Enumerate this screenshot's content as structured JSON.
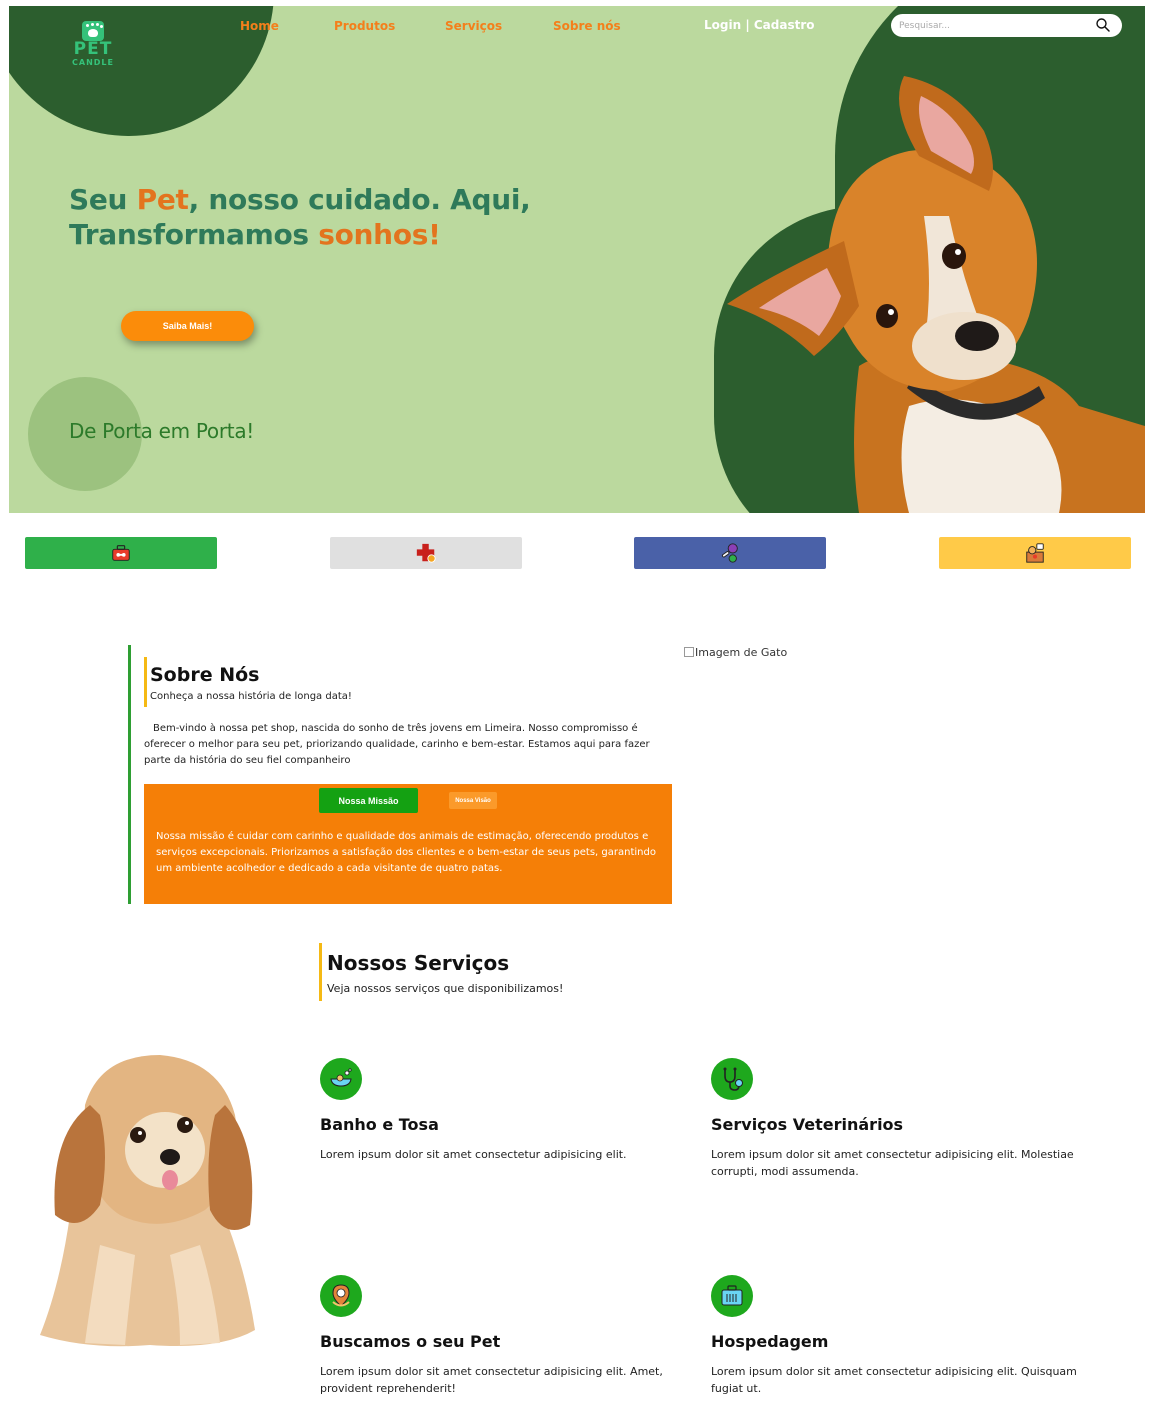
{
  "logo": {
    "line1": "PET",
    "line2": "CANDLE"
  },
  "nav": {
    "home": "Home",
    "produtos": "Produtos",
    "servicos": "Serviços",
    "sobre": "Sobre nós"
  },
  "auth": {
    "label": "Login | Cadastro"
  },
  "search": {
    "placeholder": "Pesquisar..."
  },
  "hero": {
    "headline_1": "Seu ",
    "headline_2": "Pet",
    "headline_3": ", nosso cuidado. Aqui,",
    "headline_4": "Transformamos ",
    "headline_5": "sonhos!",
    "cta": "Saiba Mais!",
    "tagline": "De Porta em Porta!"
  },
  "colors": {
    "accent_orange": "#f57f07",
    "dark_green": "#2c5e2e",
    "light_green": "#bbd99e",
    "button_green": "#14a112"
  },
  "categories": [
    {
      "icon": "toolbox-icon",
      "color": "#2fb04a"
    },
    {
      "icon": "medical-cross-icon",
      "color": "#e0e0e0"
    },
    {
      "icon": "toys-icon",
      "color": "#4a61a8"
    },
    {
      "icon": "pet-box-icon",
      "color": "#ffca48"
    }
  ],
  "about": {
    "title": "Sobre Nós",
    "subtitle": "Conheça a nossa história de longa data!",
    "text": "Bem-vindo à nossa pet shop, nascida do sonho de três jovens em Limeira. Nosso compromisso é oferecer o melhor para seu pet, priorizando qualidade, carinho e bem-estar. Estamos aqui para fazer parte da história do seu fiel companheiro",
    "image_alt": "Imagem de Gato",
    "tab_mission": "Nossa Missão",
    "tab_vision": "Nossa Visão",
    "mission_text": "Nossa missão é cuidar com carinho e qualidade dos animais de estimação, oferecendo produtos e serviços excepcionais. Priorizamos a satisfação dos clientes e o bem-estar de seus pets, garantindo um ambiente acolhedor e dedicado a cada visitante de quatro patas."
  },
  "services": {
    "title": "Nossos Serviços",
    "subtitle": "Veja nossos serviços que disponibilizamos!",
    "items": [
      {
        "icon": "bathtub-icon",
        "title": "Banho e Tosa",
        "text": "Lorem ipsum dolor sit amet consectetur adipisicing elit."
      },
      {
        "icon": "stethoscope-icon",
        "title": "Serviços Veterinários",
        "text": "Lorem ipsum dolor sit amet consectetur adipisicing elit. Molestiae corrupti, modi assumenda."
      },
      {
        "icon": "location-pin-icon",
        "title": "Buscamos o seu Pet",
        "text": "Lorem ipsum dolor sit amet consectetur adipisicing elit. Amet, provident reprehenderit!"
      },
      {
        "icon": "pet-carrier-icon",
        "title": "Hospedagem",
        "text": "Lorem ipsum dolor sit amet consectetur adipisicing elit. Quisquam fugiat ut."
      }
    ]
  }
}
